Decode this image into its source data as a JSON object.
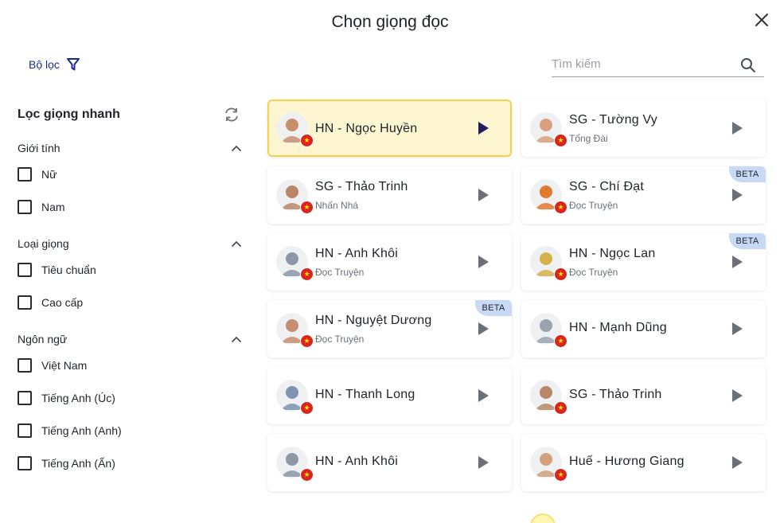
{
  "dialog": {
    "title": "Chọn giọng đọc"
  },
  "filter": {
    "label": "Bộ lọc"
  },
  "search": {
    "placeholder": "Tìm kiếm"
  },
  "sidebar": {
    "title": "Lọc giọng nhanh",
    "sections": [
      {
        "title": "Giới tính",
        "options": [
          "Nữ",
          "Nam"
        ]
      },
      {
        "title": "Loại giọng",
        "options": [
          "Tiêu chuẩn",
          "Cao cấp"
        ]
      },
      {
        "title": "Ngôn ngữ",
        "options": [
          "Việt Nam",
          "Tiếng Anh (Úc)",
          "Tiếng Anh (Anh)",
          "Tiếng Anh (Ấn)"
        ]
      }
    ]
  },
  "voices": [
    {
      "name": "HN - Ngọc Huyền",
      "style": "",
      "beta": "",
      "selected": true,
      "color": "#c98f6b"
    },
    {
      "name": "SG - Tường Vy",
      "style": "Tổng Đài",
      "beta": "",
      "selected": false,
      "color": "#d9a07d"
    },
    {
      "name": "SG - Thảo Trinh",
      "style": "Nhấn Nhá",
      "beta": "",
      "selected": false,
      "color": "#b8876a"
    },
    {
      "name": "SG - Chí Đạt",
      "style": "Đọc Truyện",
      "beta": "BETA",
      "selected": false,
      "color": "#e07a2e"
    },
    {
      "name": "HN - Anh Khôi",
      "style": "Đọc Truyện",
      "beta": "",
      "selected": false,
      "color": "#8c98a6"
    },
    {
      "name": "HN - Ngọc Lan",
      "style": "Đọc Truyện",
      "beta": "BETA",
      "selected": false,
      "color": "#d6b24a"
    },
    {
      "name": "HN - Nguyệt Dương",
      "style": "Đọc Truyện",
      "beta": "BETA",
      "selected": false,
      "color": "#c58d72"
    },
    {
      "name": "HN - Mạnh Dũng",
      "style": "",
      "beta": "",
      "selected": false,
      "color": "#9aa3ad"
    },
    {
      "name": "HN - Thanh Long",
      "style": "",
      "beta": "",
      "selected": false,
      "color": "#7c93b3"
    },
    {
      "name": "SG - Thảo Trinh",
      "style": "",
      "beta": "",
      "selected": false,
      "color": "#b8876a"
    },
    {
      "name": "HN - Anh Khôi",
      "style": "",
      "beta": "",
      "selected": false,
      "color": "#8c98a6"
    },
    {
      "name": "Huế - Hương Giang",
      "style": "",
      "beta": "",
      "selected": false,
      "color": "#d2a07c"
    }
  ]
}
